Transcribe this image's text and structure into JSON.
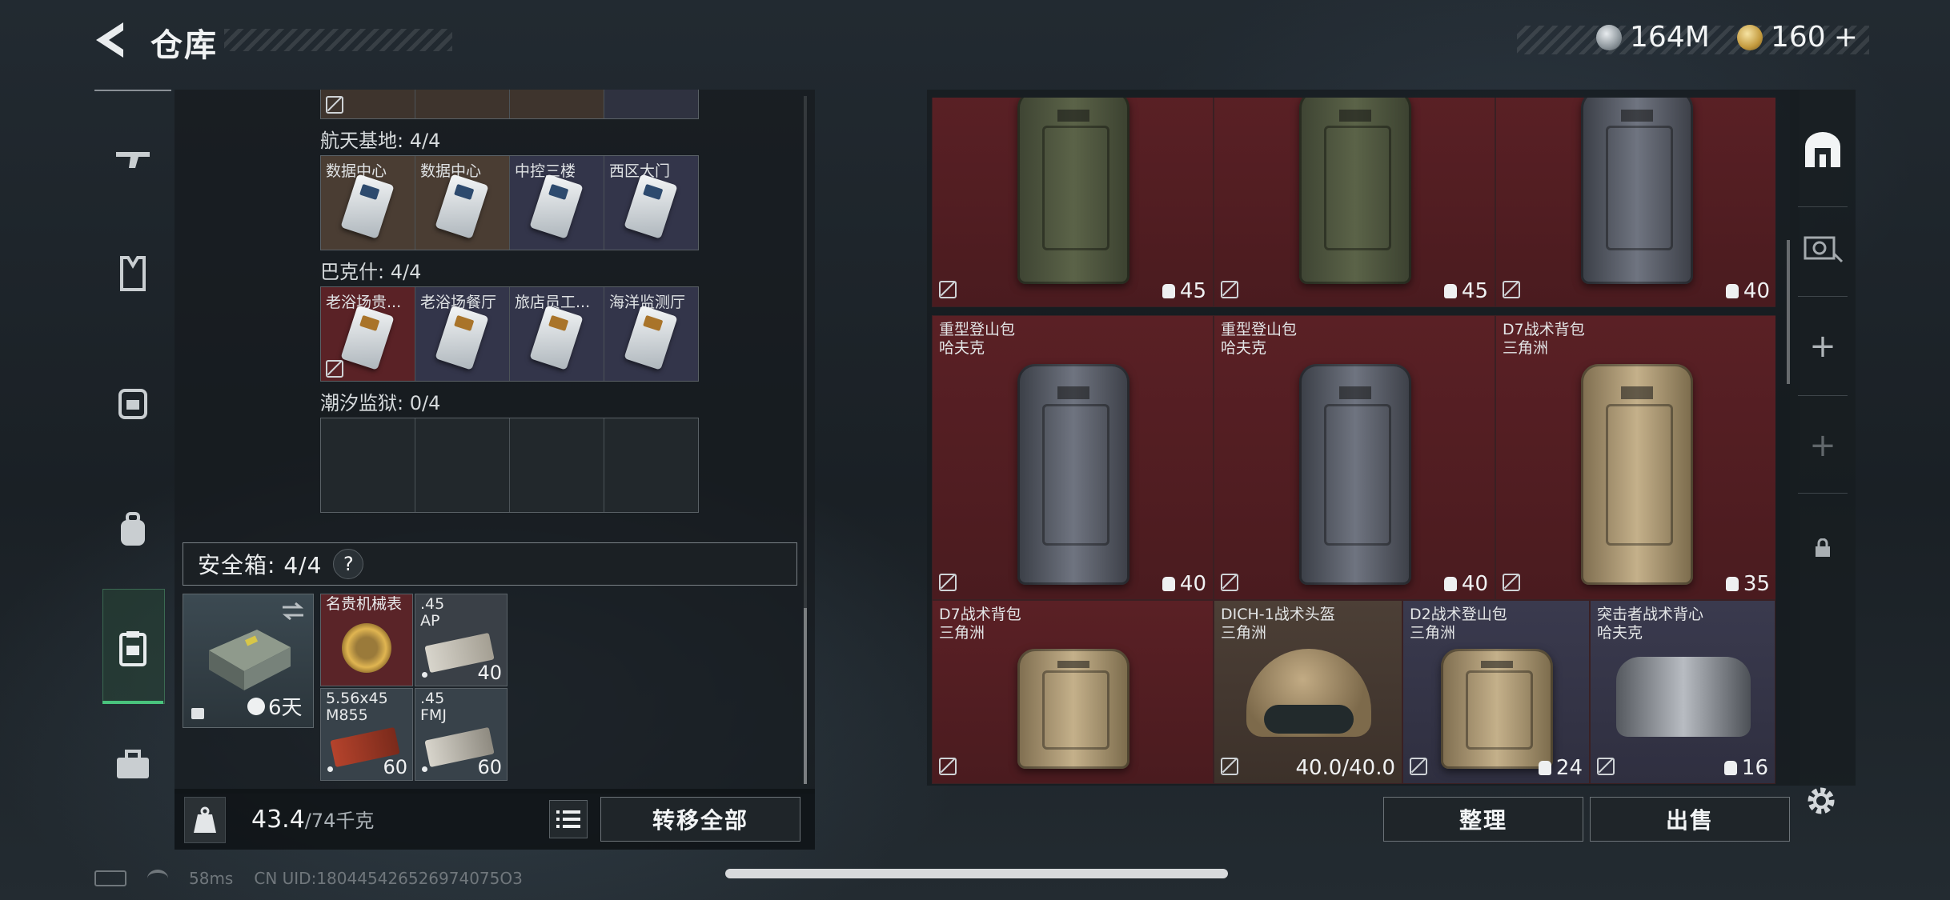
{
  "header": {
    "title": "仓库"
  },
  "currency": {
    "silver": "164M",
    "gold": "160",
    "gold_plus": "+"
  },
  "stash_sections": [
    {
      "label": "航天基地: 4/4",
      "items": [
        {
          "name": "数据中心",
          "tone": "brown"
        },
        {
          "name": "数据中心",
          "tone": "brown"
        },
        {
          "name": "中控三楼",
          "tone": "navy"
        },
        {
          "name": "西区大门",
          "tone": "navy"
        }
      ]
    },
    {
      "label": "巴克什: 4/4",
      "items": [
        {
          "name": "老浴场贵...",
          "tone": "red"
        },
        {
          "name": "老浴场餐厅",
          "tone": "navy"
        },
        {
          "name": "旅店员工...",
          "tone": "navy"
        },
        {
          "name": "海洋监测厅",
          "tone": "navy"
        }
      ]
    },
    {
      "label": "潮汐监狱: 0/4",
      "items": []
    }
  ],
  "safe_box": {
    "label": "安全箱: 4/4",
    "help": "?",
    "duration": "6天",
    "items": [
      {
        "name": "名贵机械表",
        "qty": ""
      },
      {
        "name": ".45\nAP",
        "qty": "40"
      },
      {
        "name": "5.56x45\nM855",
        "qty": "60"
      },
      {
        "name": ".45\nFMJ",
        "qty": "60"
      }
    ]
  },
  "weight": {
    "current": "43.4",
    "max": "/74千克"
  },
  "buttons": {
    "transfer_all": "转移全部",
    "organize": "整理",
    "sell": "出售"
  },
  "stash_items": [
    {
      "name": "",
      "qty": "45",
      "color": "olive",
      "bg": "red"
    },
    {
      "name": "",
      "qty": "45",
      "color": "olive",
      "bg": "red"
    },
    {
      "name": "",
      "qty": "40",
      "color": "grey",
      "bg": "red"
    },
    {
      "name": "重型登山包\n哈夫克",
      "qty": "40",
      "color": "grey",
      "bg": "red"
    },
    {
      "name": "重型登山包\n哈夫克",
      "qty": "40",
      "color": "grey",
      "bg": "red"
    },
    {
      "name": "D7战术背包\n三角洲",
      "qty": "35",
      "color": "tan",
      "bg": "red"
    },
    {
      "name": "D7战术背包\n三角洲",
      "qty": "",
      "color": "tan",
      "bg": "red"
    },
    {
      "name": "DICH-1战术头盔\n三角洲",
      "qty": "40.0/40.0",
      "color": "helmet",
      "bg": "brown"
    },
    {
      "name": "D2战术登山包\n三角洲",
      "qty": "24",
      "color": "tan",
      "bg": "navy"
    },
    {
      "name": "突击者战术背心\n哈夫克",
      "qty": "16",
      "color": "vest",
      "bg": "navy"
    }
  ],
  "status": {
    "ping": "58ms",
    "uid": "CN UID:180445426526974075O3"
  },
  "icons": [
    "back-arrow-icon",
    "rifle-icon",
    "armor-icon",
    "rig-icon",
    "backpack-icon",
    "safebox-icon",
    "toolbox-icon",
    "kg-icon",
    "list-icon",
    "shop-icon",
    "vault-icon",
    "plus-icon",
    "lock-icon",
    "gear-icon"
  ]
}
